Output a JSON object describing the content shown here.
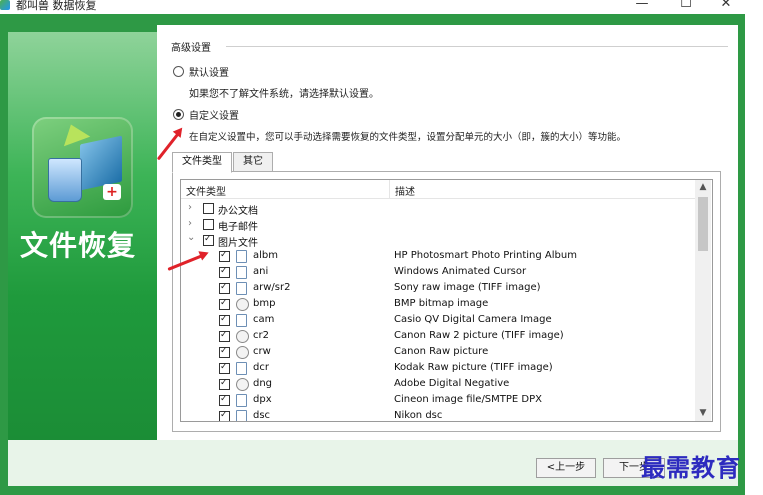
{
  "window": {
    "title": "都叫兽 数据恢复",
    "minimize": "—",
    "maximize": "☐",
    "close": "✕"
  },
  "sidebar": {
    "title": "文件恢复"
  },
  "advanced": {
    "group_label": "高级设置",
    "default_label": "默认设置",
    "default_hint": "如果您不了解文件系统，请选择默认设置。",
    "custom_label": "自定义设置",
    "custom_hint": "在自定义设置中，您可以手动选择需要恢复的文件类型，设置分配单元的大小（即，簇的大小）等功能。"
  },
  "tabs": [
    {
      "label": "文件类型"
    },
    {
      "label": "其它"
    }
  ],
  "tree": {
    "col_type": "文件类型",
    "col_desc": "描述",
    "categories": [
      {
        "name": "办公文档",
        "expander": "›"
      },
      {
        "name": "电子邮件",
        "expander": "›"
      },
      {
        "name": "图片文件",
        "expander": "⌄"
      }
    ],
    "rows": [
      {
        "ext": "albm",
        "desc": "HP Photosmart Photo Printing Album",
        "icon": "doc"
      },
      {
        "ext": "ani",
        "desc": "Windows Animated Cursor",
        "icon": "doc"
      },
      {
        "ext": "arw/sr2",
        "desc": "Sony raw image (TIFF image)",
        "icon": "doc"
      },
      {
        "ext": "bmp",
        "desc": "BMP bitmap image",
        "icon": "img"
      },
      {
        "ext": "cam",
        "desc": "Casio QV Digital Camera Image",
        "icon": "doc"
      },
      {
        "ext": "cr2",
        "desc": "Canon Raw 2 picture (TIFF image)",
        "icon": "img"
      },
      {
        "ext": "crw",
        "desc": "Canon Raw picture",
        "icon": "img"
      },
      {
        "ext": "dcr",
        "desc": "Kodak Raw picture (TIFF image)",
        "icon": "doc"
      },
      {
        "ext": "dng",
        "desc": "Adobe Digital Negative",
        "icon": "img"
      },
      {
        "ext": "dpx",
        "desc": "Cineon image file/SMTPE DPX",
        "icon": "doc"
      },
      {
        "ext": "dsc",
        "desc": "Nikon dsc",
        "icon": "doc"
      }
    ],
    "scroll_up": "▲",
    "scroll_down": "▼"
  },
  "buttons": {
    "prev": "<上一步",
    "next": "下一步"
  },
  "watermark": "最需教育"
}
